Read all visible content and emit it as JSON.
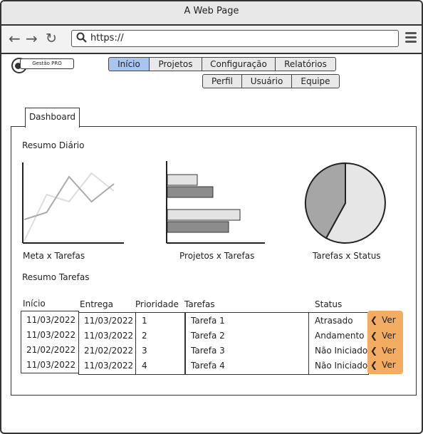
{
  "window": {
    "title": "A Web Page",
    "url": "https://"
  },
  "logo": {
    "text": "Gestão PRO"
  },
  "nav": {
    "primary": [
      "Início",
      "Projetos",
      "Configuração",
      "Relatórios"
    ],
    "secondary": [
      "Perfil",
      "Usuário",
      "Equipe"
    ],
    "active": "Início"
  },
  "dashboard": {
    "tab_label": "Dashboard",
    "summary_title": "Resumo Diário",
    "charts": {
      "line_caption": "Meta x Tarefas",
      "bar_caption": "Projetos x Tarefas",
      "pie_caption": "Tarefas x Status"
    },
    "tasks_title": "Resumo Tarefas"
  },
  "table": {
    "headers": {
      "start": "Início",
      "delivery": "Entrega",
      "priority": "Prioridade",
      "tasks": "Tarefas",
      "status": "Status"
    },
    "rows": [
      {
        "start": "11/03/2022",
        "delivery": "11/03/2022",
        "priority": "1",
        "task": "Tarefa 1",
        "status": "Atrasado",
        "action": "Ver"
      },
      {
        "start": "11/03/2022",
        "delivery": "11/03/2022",
        "priority": "2",
        "task": "Tarefa 2",
        "status": "Andamento",
        "action": "Ver"
      },
      {
        "start": "21/02/2022",
        "delivery": "21/02/2022",
        "priority": "3",
        "task": "Tarefa 3",
        "status": "Não Iniciado",
        "action": "Ver"
      },
      {
        "start": "11/03/2022",
        "delivery": "11/03/2022",
        "priority": "4",
        "task": "Tarefa 4",
        "status": "Não Iniciado",
        "action": "Ver"
      }
    ]
  },
  "icons": {
    "back": "arrow-left-icon",
    "forward": "arrow-right-icon",
    "reload": "reload-icon",
    "search": "search-icon",
    "menu": "hamburger-icon",
    "logo": "logo-icon",
    "view": "chevron-left-icon"
  },
  "colors": {
    "active_tab": "#a9c4ef",
    "action_column": "#f4ac62",
    "chart_dark": "#8c8c8c",
    "chart_light": "#e3e3e3"
  },
  "chart_data": [
    {
      "type": "line",
      "title": "Meta x Tarefas",
      "ylim": [
        0,
        100
      ],
      "x": [
        0,
        1,
        2,
        3,
        4
      ],
      "series": [
        {
          "values": [
            30,
            40,
            90,
            55,
            80
          ],
          "color": "#aaaaaa"
        },
        {
          "values": [
            0,
            65,
            55,
            95,
            70
          ],
          "color": "#dddddd"
        }
      ]
    },
    {
      "type": "bar",
      "title": "Projetos x Tarefas",
      "orientation": "horizontal",
      "xlim": [
        0,
        140
      ],
      "series": [
        {
          "values": [
            42,
            102
          ],
          "color": "#e3e3e3"
        },
        {
          "values": [
            64,
            86
          ],
          "color": "#8c8c8c"
        }
      ]
    },
    {
      "type": "pie",
      "title": "Tarefas x Status",
      "slices": [
        {
          "value": 58,
          "color": "#e6e6e6"
        },
        {
          "value": 42,
          "color": "#a6a6a6"
        }
      ]
    }
  ]
}
